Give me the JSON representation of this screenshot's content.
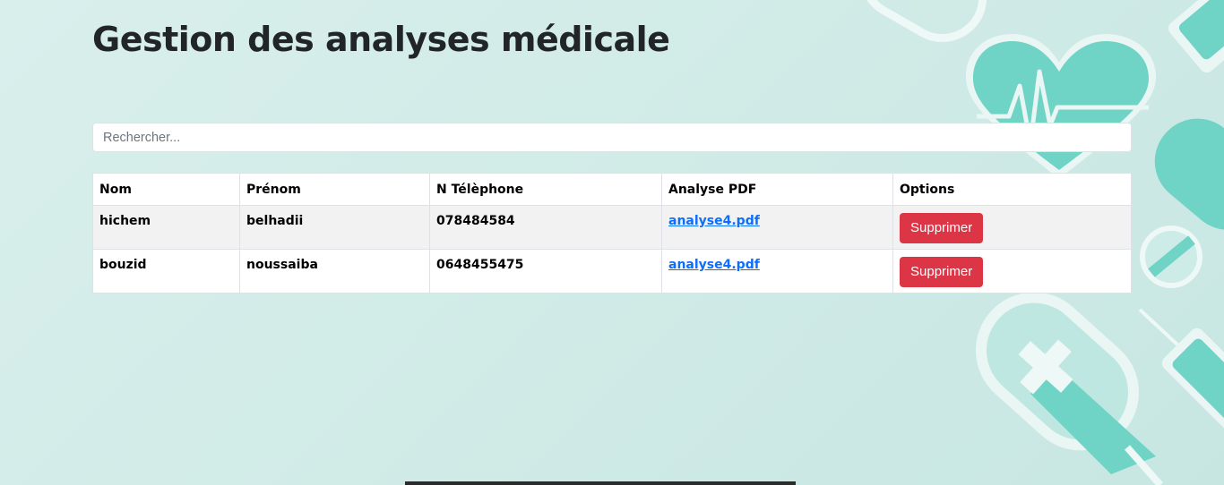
{
  "page": {
    "title": "Gestion des analyses médicale",
    "accent_color": "#dc3545",
    "link_color": "#0d6efd"
  },
  "search": {
    "placeholder": "Rechercher..."
  },
  "table": {
    "headers": [
      "Nom",
      "Prénom",
      "N Télèphone",
      "Analyse PDF",
      "Options"
    ],
    "rows": [
      {
        "nom": "hichem",
        "prenom": "belhadii",
        "telephone": "078484584",
        "pdf": "analyse4.pdf",
        "action": "Supprimer"
      },
      {
        "nom": "bouzid",
        "prenom": "noussaiba",
        "telephone": "0648455475",
        "pdf": "analyse4.pdf",
        "action": "Supprimer"
      }
    ]
  },
  "decorations": [
    "heart-pulse-icon",
    "pill-capsule-icon",
    "syringe-icon",
    "medical-cross-icon"
  ]
}
